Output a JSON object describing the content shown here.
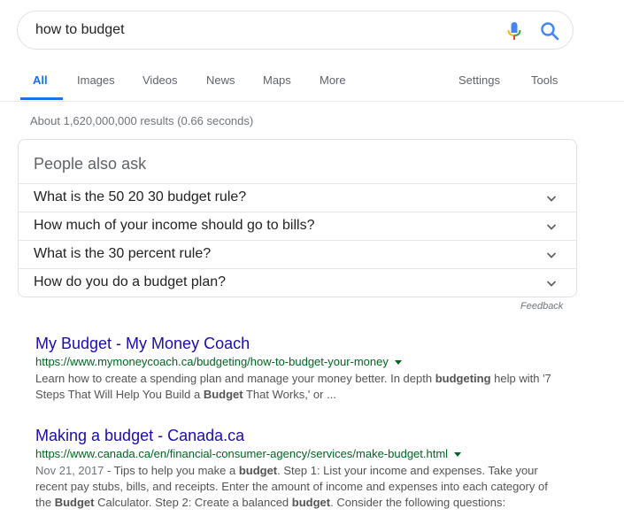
{
  "search": {
    "query": "how to budget"
  },
  "tabs": [
    {
      "label": "All",
      "active": true
    },
    {
      "label": "Images"
    },
    {
      "label": "Videos"
    },
    {
      "label": "News"
    },
    {
      "label": "Maps"
    },
    {
      "label": "More"
    },
    {
      "label": "Settings"
    },
    {
      "label": "Tools"
    }
  ],
  "result_stats": "About 1,620,000,000 results (0.66 seconds)",
  "people_also_ask": {
    "title": "People also ask",
    "questions": [
      "What is the 50 20 30 budget rule?",
      "How much of your income should go to bills?",
      "What is the 30 percent rule?",
      "How do you do a budget plan?"
    ],
    "feedback": "Feedback"
  },
  "results": [
    {
      "title": "My Budget - My Money Coach",
      "url": "https://www.mymoneycoach.ca/budgeting/how-to-budget-your-money",
      "snippet_parts": [
        {
          "t": "Learn how to create a spending plan and manage your money better. In depth "
        },
        {
          "t": "budgeting",
          "b": true
        },
        {
          "t": " help with '7 Steps That Will Help You Build a "
        },
        {
          "t": "Budget",
          "b": true
        },
        {
          "t": " That Works,' or ..."
        }
      ]
    },
    {
      "title": "Making a budget - Canada.ca",
      "url": "https://www.canada.ca/en/financial-consumer-agency/services/make-budget.html",
      "date": "Nov 21, 2017",
      "snippet_parts": [
        {
          "t": " - Tips to help you make a "
        },
        {
          "t": "budget",
          "b": true
        },
        {
          "t": ". Step 1: List your income and expenses. Take your recent pay stubs, bills, and receipts. Enter the amount of income and expenses into each category of the "
        },
        {
          "t": "Budget",
          "b": true
        },
        {
          "t": " Calculator. Step 2: Create a balanced "
        },
        {
          "t": "budget",
          "b": true
        },
        {
          "t": ". Consider the following questions:"
        }
      ]
    }
  ],
  "colors": {
    "accent": "#1a73e8",
    "link": "#1a0dab",
    "url": "#006621",
    "mic_blue": "#4285f4",
    "mic_red": "#ea4335",
    "mic_yellow": "#fbbc05",
    "mic_green": "#34a853"
  }
}
